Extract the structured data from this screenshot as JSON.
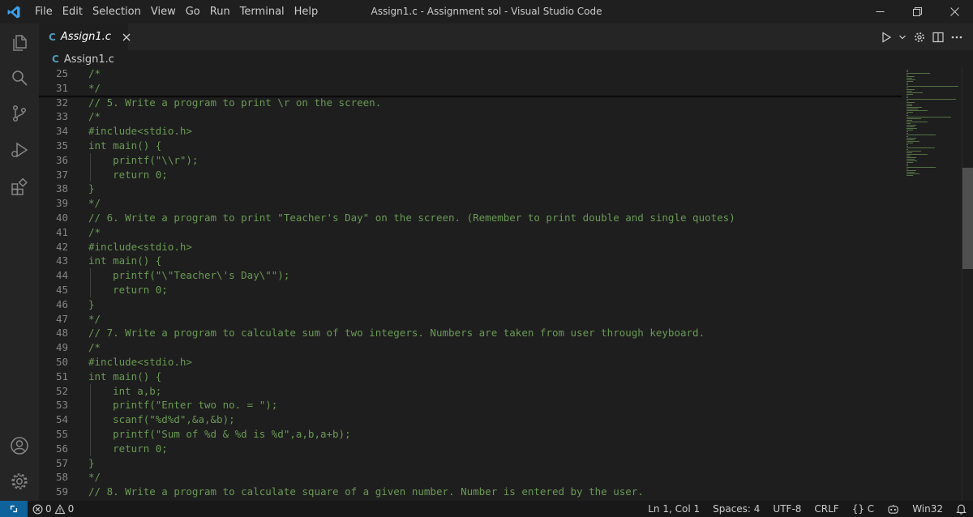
{
  "window": {
    "title": "Assign1.c - Assignment sol - Visual Studio Code",
    "menu": [
      "File",
      "Edit",
      "Selection",
      "View",
      "Go",
      "Run",
      "Terminal",
      "Help"
    ]
  },
  "tab": {
    "lang_badge": "C",
    "label": "Assign1.c"
  },
  "breadcrumb": {
    "lang_badge": "C",
    "label": "Assign1.c"
  },
  "editor": {
    "lines": [
      {
        "n": "25",
        "text": "/*",
        "indent": false
      },
      {
        "n": "31",
        "text": "*/",
        "indent": false
      },
      {
        "n": "32",
        "text": "// 5. Write a program to print \\r on the screen.",
        "indent": false
      },
      {
        "n": "33",
        "text": "/*",
        "indent": false
      },
      {
        "n": "34",
        "text": "#include<stdio.h>",
        "indent": false
      },
      {
        "n": "35",
        "text": "int main() {",
        "indent": false
      },
      {
        "n": "36",
        "text": "    printf(\"\\\\r\");",
        "indent": true
      },
      {
        "n": "37",
        "text": "    return 0;",
        "indent": true
      },
      {
        "n": "38",
        "text": "}",
        "indent": false
      },
      {
        "n": "39",
        "text": "*/",
        "indent": false
      },
      {
        "n": "40",
        "text": "// 6. Write a program to print \"Teacher's Day\" on the screen. (Remember to print double and single quotes)",
        "indent": false
      },
      {
        "n": "41",
        "text": "/*",
        "indent": false
      },
      {
        "n": "42",
        "text": "#include<stdio.h>",
        "indent": false
      },
      {
        "n": "43",
        "text": "int main() {",
        "indent": false
      },
      {
        "n": "44",
        "text": "    printf(\"\\\"Teacher\\'s Day\\\"\");",
        "indent": true
      },
      {
        "n": "45",
        "text": "    return 0;",
        "indent": true
      },
      {
        "n": "46",
        "text": "}",
        "indent": false
      },
      {
        "n": "47",
        "text": "*/",
        "indent": false
      },
      {
        "n": "48",
        "text": "// 7. Write a program to calculate sum of two integers. Numbers are taken from user through keyboard.",
        "indent": false
      },
      {
        "n": "49",
        "text": "/*",
        "indent": false
      },
      {
        "n": "50",
        "text": "#include<stdio.h>",
        "indent": false
      },
      {
        "n": "51",
        "text": "int main() {",
        "indent": false
      },
      {
        "n": "52",
        "text": "    int a,b;",
        "indent": true
      },
      {
        "n": "53",
        "text": "    printf(\"Enter two no. = \");",
        "indent": true
      },
      {
        "n": "54",
        "text": "    scanf(\"%d%d\",&a,&b);",
        "indent": true
      },
      {
        "n": "55",
        "text": "    printf(\"Sum of %d & %d is %d\",a,b,a+b);",
        "indent": true
      },
      {
        "n": "56",
        "text": "    return 0;",
        "indent": true
      },
      {
        "n": "57",
        "text": "}",
        "indent": false
      },
      {
        "n": "58",
        "text": "*/",
        "indent": false
      },
      {
        "n": "59",
        "text": "// 8. Write a program to calculate square of a given number. Number is entered by the user.",
        "indent": false
      }
    ]
  },
  "statusbar": {
    "errors": "0",
    "warnings": "0",
    "cursor": "Ln 1, Col 1",
    "spaces": "Spaces: 4",
    "encoding": "UTF-8",
    "eol": "CRLF",
    "language": "{} C",
    "platform": "Win32"
  },
  "colors": {
    "comment": "#6a9955",
    "line_number": "#858585",
    "accent": "#007acc",
    "c_badge": "#519aba"
  }
}
